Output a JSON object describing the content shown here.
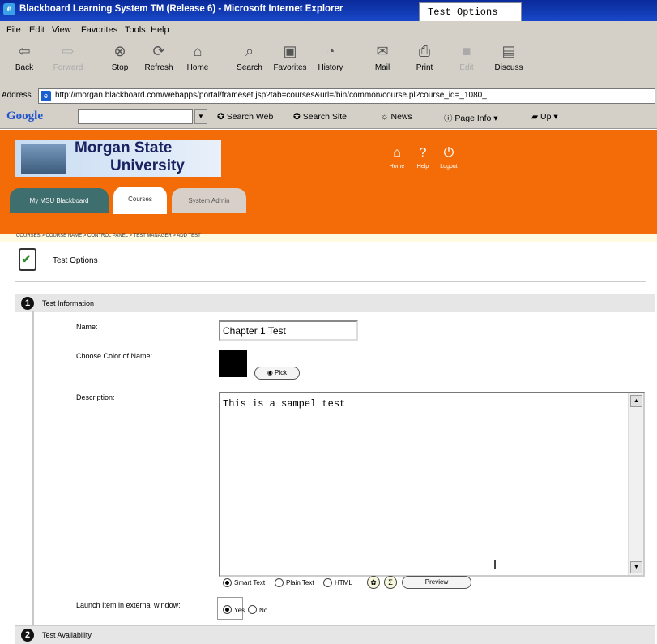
{
  "window": {
    "title": "Blackboard Learning System TM (Release 6) - Microsoft Internet Explorer",
    "popup_title": "Test Options"
  },
  "menu": [
    "File",
    "Edit",
    "View",
    "Favorites",
    "Tools",
    "Help"
  ],
  "toolbar": [
    {
      "label": "Back",
      "icon": "back-arrow-icon",
      "enabled": true
    },
    {
      "label": "Forward",
      "icon": "forward-arrow-icon",
      "enabled": false
    },
    {
      "label": "Stop",
      "icon": "stop-icon",
      "enabled": true
    },
    {
      "label": "Refresh",
      "icon": "refresh-icon",
      "enabled": true
    },
    {
      "label": "Home",
      "icon": "home-icon",
      "enabled": true
    },
    {
      "label": "Search",
      "icon": "search-icon",
      "enabled": true
    },
    {
      "label": "Favorites",
      "icon": "favorites-icon",
      "enabled": true
    },
    {
      "label": "History",
      "icon": "history-icon",
      "enabled": true
    },
    {
      "label": "Mail",
      "icon": "mail-icon",
      "enabled": true
    },
    {
      "label": "Print",
      "icon": "print-icon",
      "enabled": true
    },
    {
      "label": "Edit",
      "icon": "edit-icon",
      "enabled": false
    },
    {
      "label": "Discuss",
      "icon": "discuss-icon",
      "enabled": true
    }
  ],
  "address": {
    "label": "Address",
    "url": "http://morgan.blackboard.com/webapps/portal/frameset.jsp?tab=courses&url=/bin/common/course.pl?course_id=_1080_"
  },
  "googlebar": {
    "logo": "Google",
    "search_value": "",
    "buttons": [
      "Search Web",
      "Search Site",
      "News",
      "Page Info",
      "Up"
    ]
  },
  "header": {
    "university_line1": "Morgan State",
    "university_line2": "University",
    "icons": [
      {
        "label": "Home",
        "icon": "home-icon"
      },
      {
        "label": "Help",
        "icon": "help-icon"
      },
      {
        "label": "Logout",
        "icon": "logout-icon"
      }
    ],
    "tabs": [
      {
        "label": "My MSU Blackboard",
        "active": false
      },
      {
        "label": "Courses",
        "active": true
      },
      {
        "label": "System Admin",
        "active": false
      }
    ]
  },
  "breadcrumb": "COURSES > COURSE NAME > CONTROL PANEL > TEST MANAGER > ADD TEST",
  "page_title": "Test Options",
  "sections": [
    {
      "number": "1",
      "title": "Test Information"
    },
    {
      "number": "2",
      "title": "Test Availability"
    }
  ],
  "form": {
    "name_label": "Name:",
    "name_value": "Chapter 1 Test",
    "color_label": "Choose Color of Name:",
    "color_value": "#000000",
    "pick_button": "Pick",
    "description_label": "Description:",
    "description_value": "This is a sampel test",
    "text_format": {
      "options": [
        "Smart Text",
        "Plain Text",
        "HTML"
      ],
      "selected": "Smart Text"
    },
    "preview_button": "Preview",
    "launch_label": "Launch Item in external window:",
    "launch_options": [
      "Yes",
      "No"
    ],
    "launch_selected": "Yes"
  }
}
